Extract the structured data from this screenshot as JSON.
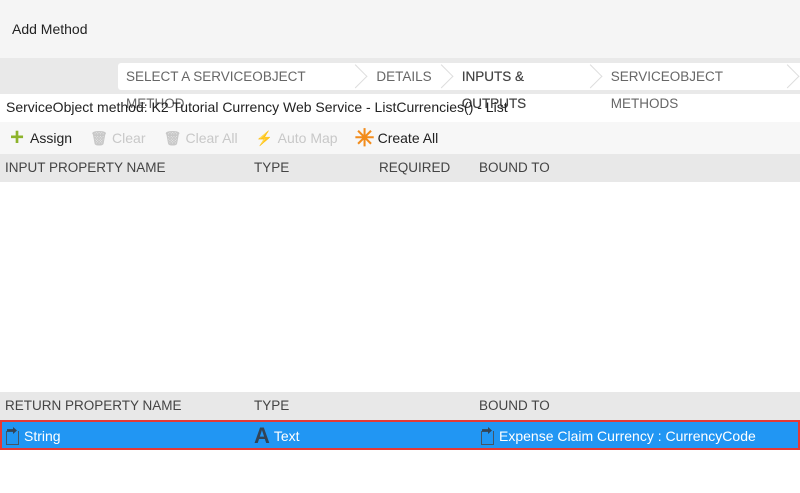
{
  "title": "Add Method",
  "wizard": {
    "steps": [
      "SELECT A SERVICEOBJECT METHOD",
      "DETAILS",
      "INPUTS & OUTPUTS",
      "SERVICEOBJECT METHODS"
    ],
    "active": 2
  },
  "subtitle": "ServiceObject method: K2 Tutorial Currency Web Service - ListCurrencies() - List",
  "toolbar": {
    "assign": "Assign",
    "clear": "Clear",
    "clear_all": "Clear All",
    "auto_map": "Auto Map",
    "create_all": "Create All"
  },
  "inputs": {
    "headers": [
      "INPUT PROPERTY NAME",
      "TYPE",
      "REQUIRED",
      "BOUND TO"
    ],
    "rows": []
  },
  "returns": {
    "headers": [
      "RETURN PROPERTY NAME",
      "TYPE",
      "BOUND TO"
    ],
    "rows": [
      {
        "name": "String",
        "type": "Text",
        "bound_to": "Expense Claim Currency : CurrencyCode"
      }
    ]
  },
  "colors": {
    "selected": "#2196f3",
    "highlight_border": "#e53935",
    "assign_icon": "#8db32b",
    "create_icon": "#f28c1c"
  }
}
